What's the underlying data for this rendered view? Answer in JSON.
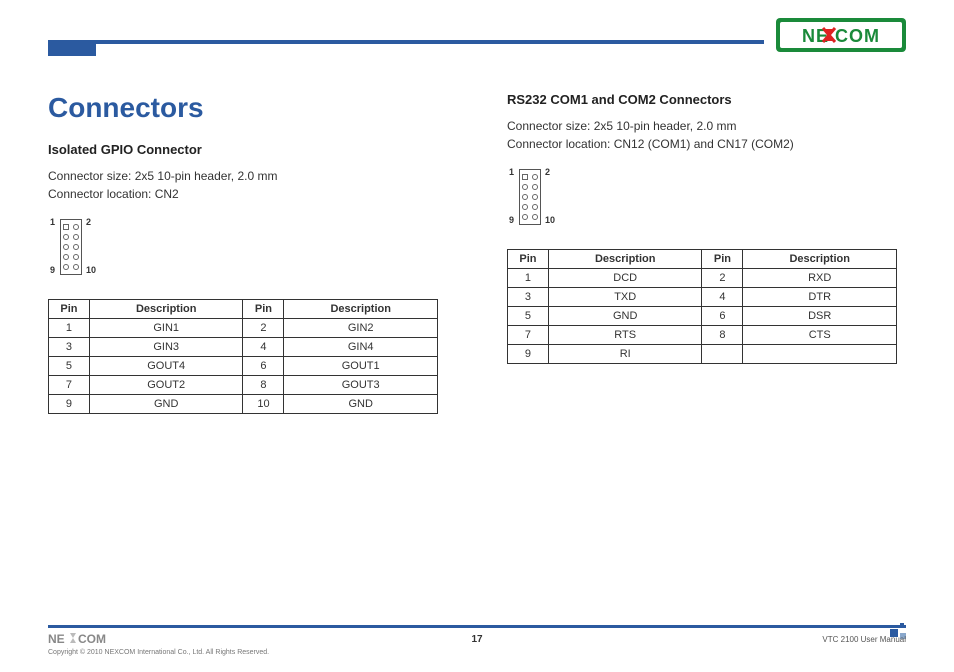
{
  "brand": "NEXCOM",
  "page_title": "Connectors",
  "left": {
    "sub_title": "Isolated GPIO Connector",
    "size_text": "Connector size: 2x5 10-pin header, 2.0 mm",
    "loc_text": "Connector location: CN2",
    "diag": {
      "tl": "1",
      "tr": "2",
      "bl": "9",
      "br": "10"
    },
    "table": {
      "headers": [
        "Pin",
        "Description",
        "Pin",
        "Description"
      ],
      "rows": [
        [
          "1",
          "GIN1",
          "2",
          "GIN2"
        ],
        [
          "3",
          "GIN3",
          "4",
          "GIN4"
        ],
        [
          "5",
          "GOUT4",
          "6",
          "GOUT1"
        ],
        [
          "7",
          "GOUT2",
          "8",
          "GOUT3"
        ],
        [
          "9",
          "GND",
          "10",
          "GND"
        ]
      ]
    }
  },
  "right": {
    "sub_title": "RS232 COM1 and COM2 Connectors",
    "size_text": "Connector size: 2x5 10-pin header, 2.0 mm",
    "loc_text": "Connector location: CN12 (COM1) and CN17 (COM2)",
    "diag": {
      "tl": "1",
      "tr": "2",
      "bl": "9",
      "br": "10"
    },
    "table": {
      "headers": [
        "Pin",
        "Description",
        "Pin",
        "Description"
      ],
      "rows": [
        [
          "1",
          "DCD",
          "2",
          "RXD"
        ],
        [
          "3",
          "TXD",
          "4",
          "DTR"
        ],
        [
          "5",
          "GND",
          "6",
          "DSR"
        ],
        [
          "7",
          "RTS",
          "8",
          "CTS"
        ],
        [
          "9",
          "RI",
          "",
          ""
        ]
      ]
    }
  },
  "footer": {
    "copyright": "Copyright © 2010 NEXCOM International Co., Ltd. All Rights Reserved.",
    "page_num": "17",
    "doc_ref": "VTC 2100 User Manual"
  }
}
